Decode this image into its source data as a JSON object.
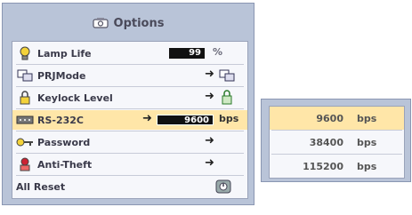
{
  "menu": {
    "title": "Options",
    "title_icon": "options-icon",
    "items": [
      {
        "label": "Lamp Life",
        "icon": "lamp-icon",
        "value": "99",
        "unit": "%"
      },
      {
        "label": "PRJMode",
        "icon": "projector-mode-icon"
      },
      {
        "label": "Keylock Level",
        "icon": "lock-icon"
      },
      {
        "label": "RS-232C",
        "icon": "rs232c-icon",
        "value": "9600",
        "unit": "bps"
      },
      {
        "label": "Password",
        "icon": "key-icon"
      },
      {
        "label": "Anti-Theft",
        "icon": "anti-theft-icon"
      },
      {
        "label": "All Reset",
        "icon": "reset-icon"
      }
    ]
  },
  "baud_popup": {
    "options": [
      {
        "value": "9600",
        "unit": "bps",
        "selected": true
      },
      {
        "value": "38400",
        "unit": "bps",
        "selected": false
      },
      {
        "value": "115200",
        "unit": "bps",
        "selected": false
      }
    ]
  },
  "colors": {
    "panel_bg": "#b9c4d8",
    "list_bg": "#f6f7fb",
    "highlight": "#ffe6a8"
  }
}
